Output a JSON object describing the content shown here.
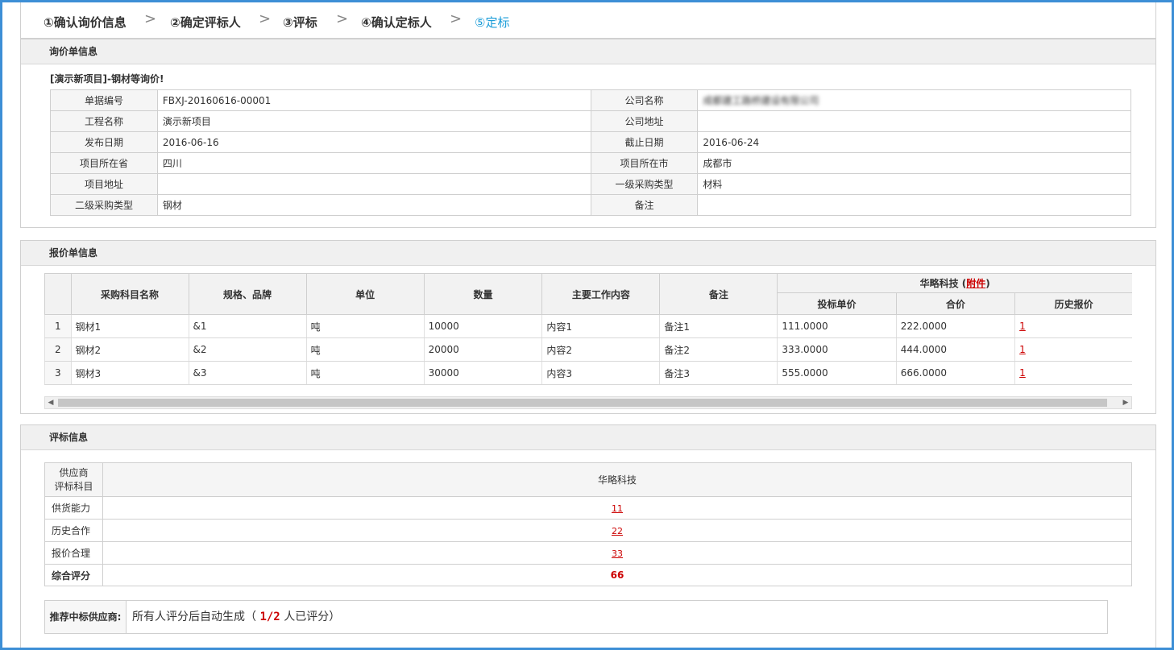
{
  "steps": [
    {
      "label": "①确认询价信息",
      "active": false
    },
    {
      "label": "②确定评标人",
      "active": false
    },
    {
      "label": "③评标",
      "active": false
    },
    {
      "label": "④确认定标人",
      "active": false
    },
    {
      "label": "⑤定标",
      "active": true
    }
  ],
  "step_separator": ">",
  "inquiry": {
    "section_title": "询价单信息",
    "title": "[演示新项目]-钢材等询价!",
    "rows": [
      [
        "单据编号",
        "FBXJ-20160616-00001",
        "公司名称",
        "成都建工路桥建设有限公司"
      ],
      [
        "工程名称",
        "演示新项目",
        "公司地址",
        ""
      ],
      [
        "发布日期",
        "2016-06-16",
        "截止日期",
        "2016-06-24"
      ],
      [
        "项目所在省",
        "四川",
        "项目所在市",
        "成都市"
      ],
      [
        "项目地址",
        "",
        "一级采购类型",
        "材料"
      ],
      [
        "二级采购类型",
        "钢材",
        "备注",
        ""
      ]
    ]
  },
  "quote": {
    "section_title": "报价单信息",
    "headers": [
      "采购科目名称",
      "规格、品牌",
      "单位",
      "数量",
      "主要工作内容",
      "备注"
    ],
    "supplier": "华略科技",
    "attachment_label": "附件",
    "supplier_headers": [
      "投标单价",
      "合价",
      "历史报价"
    ],
    "rows": [
      [
        "1",
        "钢材1",
        "&1",
        "吨",
        "10000",
        "内容1",
        "备注1",
        "111.0000",
        "222.0000",
        "1"
      ],
      [
        "2",
        "钢材2",
        "&2",
        "吨",
        "20000",
        "内容2",
        "备注2",
        "333.0000",
        "444.0000",
        "1"
      ],
      [
        "3",
        "钢材3",
        "&3",
        "吨",
        "30000",
        "内容3",
        "备注3",
        "555.0000",
        "666.0000",
        "1"
      ]
    ]
  },
  "evaluation": {
    "section_title": "评标信息",
    "corner_top": "供应商",
    "corner_bottom": "评标科目",
    "supplier": "华略科技",
    "rows": [
      {
        "item": "供货能力",
        "score": "11"
      },
      {
        "item": "历史合作",
        "score": "22"
      },
      {
        "item": "报价合理",
        "score": "33"
      }
    ],
    "total_label": "综合评分",
    "total_score": "66",
    "recommend_label": "推荐中标供应商:",
    "recommend_prefix": "所有人评分后自动生成（",
    "recommend_count": "1/2",
    "recommend_suffix": "人已评分）"
  },
  "colors": {
    "accent": "#1a9cd8",
    "frame": "#3d8fd6",
    "link": "#cc0000"
  }
}
